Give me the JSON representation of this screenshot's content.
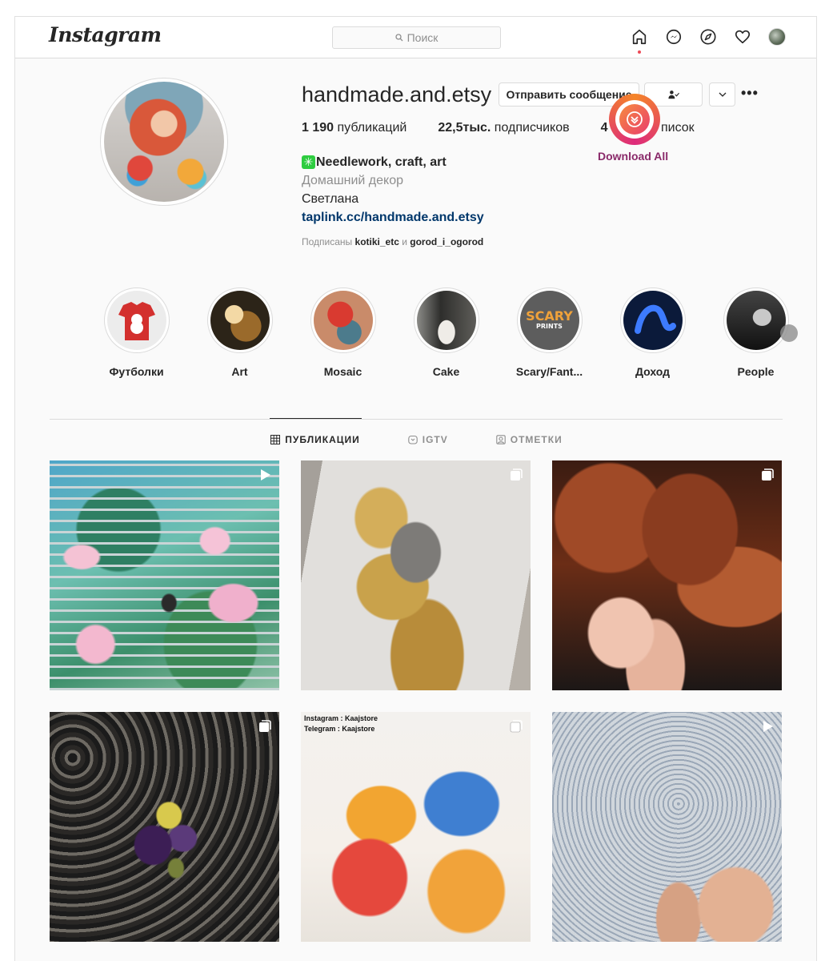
{
  "app": {
    "logo_text": "Instagram"
  },
  "search": {
    "placeholder": "Поиск"
  },
  "nav": {
    "icons": [
      "home-icon",
      "messenger-icon",
      "explore-icon",
      "heart-icon",
      "profile-avatar"
    ]
  },
  "profile": {
    "username": "handmade.and.etsy",
    "buttons": {
      "message": "Отправить сообщение"
    },
    "stats": {
      "posts_count": "1 190",
      "posts_label": "публикаций",
      "followers_count": "22,5тыс.",
      "followers_label": "подписчиков",
      "following_count": "4",
      "following_label": "писок"
    },
    "bio": {
      "emoji": "✳",
      "name": "Needlework, craft, art",
      "category": "Домашний декор",
      "line": "Светлана",
      "link": "taplink.cc/handmade.and.etsy"
    },
    "followed_by": {
      "prefix": "Подписаны",
      "user1": "kotiki_etc",
      "joiner": "и",
      "user2": "gorod_i_ogorod"
    }
  },
  "extension": {
    "download_all": "Download All"
  },
  "highlights": [
    {
      "label": "Футболки"
    },
    {
      "label": "Art"
    },
    {
      "label": "Mosaic"
    },
    {
      "label": "Cake"
    },
    {
      "label": "Scary/Fant..."
    },
    {
      "label": "Доход"
    },
    {
      "label": "People"
    }
  ],
  "highlight_art": {
    "scary_top": "SCARY",
    "scary_bottom": "PRINTS"
  },
  "tabs": [
    {
      "label": "ПУБЛИКАЦИИ",
      "active": true
    },
    {
      "label": "IGTV",
      "active": false
    },
    {
      "label": "ОТМЕТКИ",
      "active": false
    }
  ],
  "posts": [
    {
      "type": "video"
    },
    {
      "type": "carousel"
    },
    {
      "type": "carousel"
    },
    {
      "type": "carousel"
    },
    {
      "type": "carousel",
      "overlay_line1": "Instagram : Kaajstore",
      "overlay_line2": "Telegram : Kaajstore"
    },
    {
      "type": "video"
    }
  ],
  "colors": {
    "link": "#00376b",
    "download_label": "#8a2a6a",
    "notification_dot": "#ed4956"
  }
}
